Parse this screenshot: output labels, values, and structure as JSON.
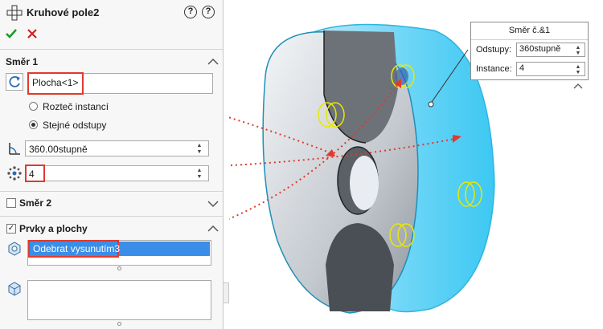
{
  "header": {
    "title": "Kruhové pole2",
    "help_icon": "help-icon",
    "detail_icon": "question-icon"
  },
  "actions": {
    "ok_icon": "checkmark-icon",
    "cancel_icon": "x-icon",
    "ok_color": "#1a9a2a",
    "cancel_color": "#d02020"
  },
  "direction1": {
    "label": "Směr 1",
    "direction_field": "Plocha<1>",
    "radio_pitch": "Rozteč instancí",
    "radio_equal": "Stejné odstupy",
    "angle_value": "360.00stupně",
    "count_value": "4"
  },
  "direction2": {
    "label": "Směr 2"
  },
  "features": {
    "label": "Prvky a plochy",
    "selected_item": "Odebrat vysunutím3"
  },
  "callout": {
    "title": "Směr č.&1",
    "spacing_label": "Odstupy:",
    "spacing_value": "360stupně",
    "instances_label": "Instance:",
    "instances_value": "4"
  },
  "colors": {
    "highlight": "#e03a2e",
    "selection": "#3a8ee8",
    "model_cyan": "#4fd0f5"
  }
}
